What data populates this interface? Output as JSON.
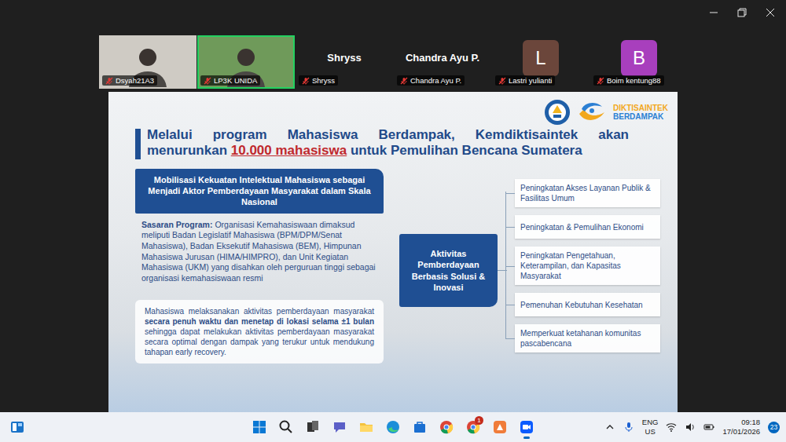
{
  "window": {
    "controls": [
      {
        "kind": "minimize"
      },
      {
        "kind": "restore"
      },
      {
        "kind": "close"
      }
    ]
  },
  "participants": [
    {
      "name": "Dsyah21A3",
      "kind": "video",
      "muted": true,
      "active_speaker": false,
      "color": "#cfcbc4"
    },
    {
      "name": "LP3K UNIDA",
      "kind": "video",
      "muted": true,
      "active_speaker": true,
      "color": "#6f9a5a"
    },
    {
      "name": "Shryss",
      "kind": "name",
      "display": "Shryss",
      "muted": true,
      "active_speaker": false
    },
    {
      "name": "Chandra Ayu P.",
      "kind": "name",
      "display": "Chandra Ayu P.",
      "muted": true,
      "active_speaker": false
    },
    {
      "name": "Lastri yulianti",
      "kind": "avatar",
      "initial": "L",
      "color": "#6b463b",
      "muted": true,
      "active_speaker": false
    },
    {
      "name": "Boim kentung88",
      "kind": "avatar",
      "initial": "B",
      "color": "#a83fbd",
      "muted": true,
      "active_speaker": false
    }
  ],
  "slide": {
    "logo": {
      "line1": "DIKTISAINTEK",
      "line2": "BERDAMPAK"
    },
    "title": [
      {
        "text": "Melalui program Mahasiswa Berdampak, Kemdiktisaintek akan menurunkan ",
        "highlight": false
      },
      {
        "text": "10.000 mahasiswa",
        "highlight": true
      },
      {
        "text": " untuk Pemulihan Bencana Sumatera",
        "highlight": false
      }
    ],
    "header": "Mobilisasi Kekuatan Intelektual Mahasiswa sebagai Menjadi Aktor Pemberdayaan Masyarakat dalam Skala Nasional",
    "target_label": "Sasaran Program:",
    "target_text": " Organisasi Kemahasiswaan dimaksud meliputi Badan Legislatif Mahasiswa (BPM/DPM/Senat Mahasiswa), Badan Eksekutif Mahasiswa (BEM), Himpunan Mahasiswa Jurusan (HIMA/HIMPRO), dan Unit Kegiatan Mahasiswa (UKM) yang disahkan oleh perguruan tinggi sebagai organisasi kemahasiswaan resmi",
    "note": [
      {
        "text": "Mahasiswa melaksanakan aktivitas pemberdayaan masyarakat ",
        "bold": false
      },
      {
        "text": "secara penuh waktu dan menetap di lokasi selama ±1 bulan",
        "bold": true
      },
      {
        "text": " sehingga dapat melakukan aktivitas pemberdayaan masyarakat secara optimal dengan dampak yang terukur untuk mendukung tahapan early recovery.",
        "bold": false
      }
    ],
    "center": "Aktivitas Pemberdayaan Berbasis Solusi & Inovasi",
    "activities": [
      "Peningkatan Akses Layanan Publik & Fasilitas Umum",
      "Peningkatan & Pemulihan Ekonomi",
      "Peningkatan Pengetahuan, Keterampilan, dan Kapasitas Masyarakat",
      "Pemenuhan Kebutuhan Kesehatan",
      "Memperkuat ketahanan komunitas pascabencana"
    ]
  },
  "taskbar": {
    "apps": [
      {
        "kind": "start",
        "active": false
      },
      {
        "kind": "search",
        "active": false
      },
      {
        "kind": "taskview",
        "active": false
      },
      {
        "kind": "chat",
        "active": false
      },
      {
        "kind": "explorer",
        "active": false
      },
      {
        "kind": "edge",
        "active": false
      },
      {
        "kind": "store",
        "active": false
      },
      {
        "kind": "chrome",
        "active": false
      },
      {
        "kind": "chrome",
        "active": false,
        "badge": "1"
      },
      {
        "kind": "orange-app",
        "active": false
      },
      {
        "kind": "zoom",
        "active": true
      }
    ],
    "tray": {
      "language": "ENG",
      "region": "US",
      "time": "09:18",
      "date": "17/01/2026",
      "notifications": "23"
    }
  }
}
